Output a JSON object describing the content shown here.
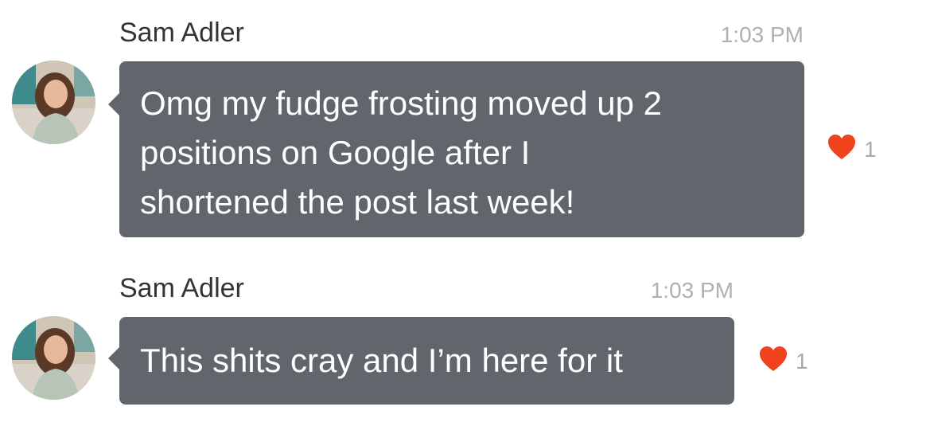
{
  "messages": [
    {
      "sender": "Sam Adler",
      "time": "1:03 PM",
      "text": "Omg my fudge frosting moved up 2\npositions on Google after I\nshortened the post last week!",
      "reaction": {
        "icon": "heart-icon",
        "count": "1",
        "color": "#f0421c"
      }
    },
    {
      "sender": "Sam Adler",
      "time": "1:03 PM",
      "text": "This shits cray and I’m here for it",
      "reaction": {
        "icon": "heart-icon",
        "count": "1",
        "color": "#f0421c"
      }
    }
  ],
  "theme": {
    "bubble_color": "#61666d",
    "bubble_text_color": "#ffffff",
    "sender_color": "#333333",
    "time_color": "#b0b0b0"
  }
}
